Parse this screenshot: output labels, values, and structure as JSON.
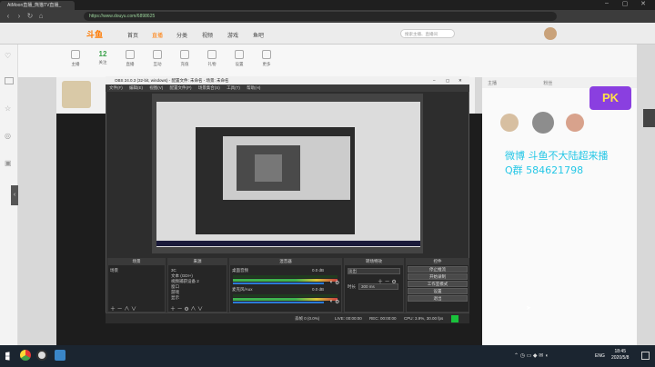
{
  "browser": {
    "tab_title": "AtMoon直播_熊猫TV直播_",
    "url": "https://www.douyu.com/6898625"
  },
  "site": {
    "logo": "斗鱼",
    "nav": [
      "首页",
      "直播",
      "分类",
      "视频",
      "游戏",
      "鱼吧"
    ],
    "search_placeholder": "搜索主播、直播间",
    "tools": [
      {
        "count": "",
        "label": "主播"
      },
      {
        "count": "12",
        "label": "关注"
      },
      {
        "count": "",
        "label": "直播"
      },
      {
        "count": "",
        "label": "互动"
      },
      {
        "count": "",
        "label": "充值"
      },
      {
        "count": "",
        "label": "礼物"
      },
      {
        "count": "",
        "label": "设置"
      },
      {
        "count": "",
        "label": "更多"
      }
    ],
    "right_panel_tabs": [
      "主播",
      "粉丝"
    ],
    "pk_badge": "PK"
  },
  "obs": {
    "title": "OBS 24.0.3 (32-bit, windows) - 配置文件: 未命名 - 场景: 未命名",
    "menu": [
      "文件(F)",
      "编辑(E)",
      "视图(V)",
      "配置文件(P)",
      "场景集合(S)",
      "工具(T)",
      "帮助(H)"
    ],
    "docks": {
      "scenes": {
        "title": "场景",
        "items": [
          "场景"
        ]
      },
      "sources": {
        "title": "来源",
        "items": [
          "3C",
          "文本 (GDI+)",
          "视频捕获设备 2",
          "窗口",
          "游戏",
          "显示"
        ]
      },
      "mixer": {
        "title": "混音器",
        "channels": [
          {
            "name": "桌面音频",
            "db": "0.0 dB"
          },
          {
            "name": "麦克风/Aux",
            "db": "0.0 dB"
          }
        ]
      },
      "transitions": {
        "title": "转场特效",
        "type": "淡出",
        "duration_label": "时长",
        "duration": "300 ms"
      },
      "controls": {
        "title": "控件",
        "buttons": [
          "停止推流",
          "开始录制",
          "工作室模式",
          "设置",
          "退出"
        ]
      }
    },
    "status": {
      "dropped": "丢帧 0 (0.0%)",
      "live": "LIVE: 00:00:00",
      "rec": "REC: 00:00:00",
      "cpu": "CPU: 3.9%, 30.00 fps"
    }
  },
  "overlay": {
    "line1": "微博 斗鱼不大陆超来播",
    "line2": "Q群 584621798"
  },
  "taskbar": {
    "lang": "ENG",
    "time": "18:45",
    "date": "2020/5/8"
  },
  "colors": {
    "accent": "#ff7a00",
    "overlay_text": "#25c7e6",
    "live_indicator": "#19c23b"
  }
}
